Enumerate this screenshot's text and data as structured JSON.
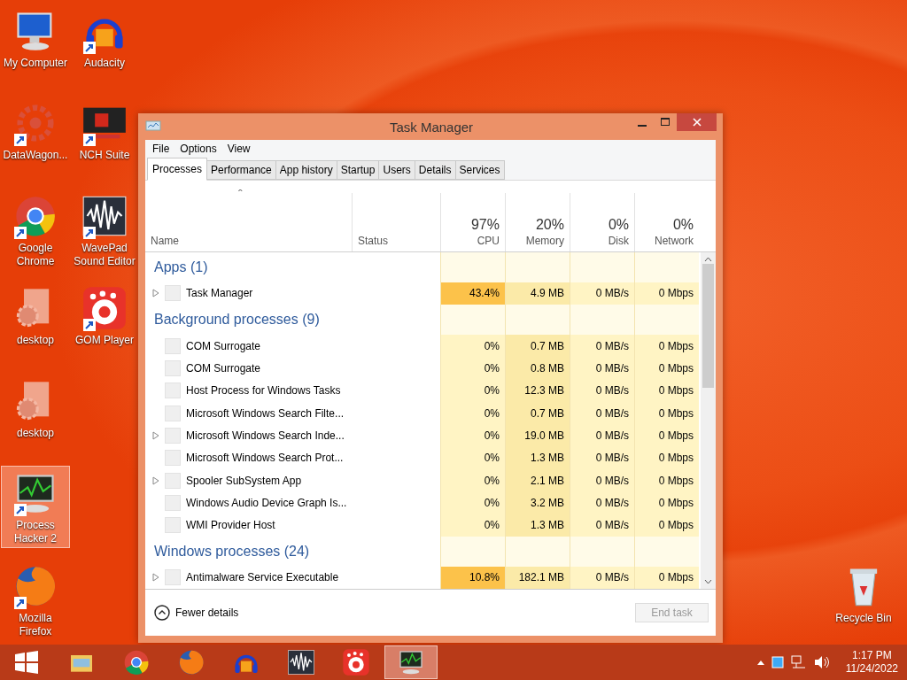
{
  "desktop_icons": [
    {
      "label": "My Computer",
      "kind": "computer",
      "shortcut": false,
      "selected": false
    },
    {
      "label": "Audacity",
      "kind": "headphones",
      "shortcut": true,
      "selected": false
    },
    {
      "label": "DataWagon...",
      "kind": "gear",
      "shortcut": true,
      "selected": false
    },
    {
      "label": "NCH Suite",
      "kind": "nch",
      "shortcut": true,
      "selected": false
    },
    {
      "label": "Google Chrome",
      "kind": "chrome",
      "shortcut": true,
      "selected": false
    },
    {
      "label": "WavePad Sound Editor",
      "kind": "wave",
      "shortcut": true,
      "selected": false
    },
    {
      "label": "desktop",
      "kind": "gear-doc",
      "shortcut": false,
      "selected": false
    },
    {
      "label": "GOM Player",
      "kind": "gom",
      "shortcut": true,
      "selected": false
    },
    {
      "label": "desktop",
      "kind": "gear-doc",
      "shortcut": false,
      "selected": false
    },
    {
      "label": "Process Hacker 2",
      "kind": "monitor",
      "shortcut": true,
      "selected": true
    },
    {
      "label": "Mozilla Firefox",
      "kind": "firefox",
      "shortcut": true,
      "selected": false
    },
    {
      "label": "Recycle Bin",
      "kind": "bin",
      "shortcut": false,
      "selected": false
    }
  ],
  "window": {
    "title": "Task Manager",
    "menu": [
      "File",
      "Options",
      "View"
    ],
    "tabs": [
      {
        "label": "Processes",
        "selected": true
      },
      {
        "label": "Performance",
        "selected": false
      },
      {
        "label": "App history",
        "selected": false
      },
      {
        "label": "Startup",
        "selected": false
      },
      {
        "label": "Users",
        "selected": false
      },
      {
        "label": "Details",
        "selected": false
      },
      {
        "label": "Services",
        "selected": false
      }
    ],
    "columns": [
      {
        "label": "Name"
      },
      {
        "label": "Status"
      },
      {
        "label": "CPU",
        "total": "97%"
      },
      {
        "label": "Memory",
        "total": "20%"
      },
      {
        "label": "Disk",
        "total": "0%"
      },
      {
        "label": "Network",
        "total": "0%"
      }
    ],
    "sort_indicator": "ˆ",
    "groups": [
      {
        "title": "Apps (1)",
        "rows": [
          {
            "name": "Task Manager",
            "expandable": true,
            "hot": true,
            "cpu": "43.4%",
            "memory": "4.9 MB",
            "disk": "0 MB/s",
            "network": "0 Mbps"
          }
        ]
      },
      {
        "title": "Background processes (9)",
        "rows": [
          {
            "name": "COM Surrogate",
            "expandable": false,
            "hot": false,
            "cpu": "0%",
            "memory": "0.7 MB",
            "disk": "0 MB/s",
            "network": "0 Mbps"
          },
          {
            "name": "COM Surrogate",
            "expandable": false,
            "hot": false,
            "cpu": "0%",
            "memory": "0.8 MB",
            "disk": "0 MB/s",
            "network": "0 Mbps"
          },
          {
            "name": "Host Process for Windows Tasks",
            "expandable": false,
            "hot": false,
            "cpu": "0%",
            "memory": "12.3 MB",
            "disk": "0 MB/s",
            "network": "0 Mbps"
          },
          {
            "name": "Microsoft Windows Search Filte...",
            "expandable": false,
            "hot": false,
            "cpu": "0%",
            "memory": "0.7 MB",
            "disk": "0 MB/s",
            "network": "0 Mbps"
          },
          {
            "name": "Microsoft Windows Search Inde...",
            "expandable": true,
            "hot": false,
            "cpu": "0%",
            "memory": "19.0 MB",
            "disk": "0 MB/s",
            "network": "0 Mbps"
          },
          {
            "name": "Microsoft Windows Search Prot...",
            "expandable": false,
            "hot": false,
            "cpu": "0%",
            "memory": "1.3 MB",
            "disk": "0 MB/s",
            "network": "0 Mbps"
          },
          {
            "name": "Spooler SubSystem App",
            "expandable": true,
            "hot": false,
            "cpu": "0%",
            "memory": "2.1 MB",
            "disk": "0 MB/s",
            "network": "0 Mbps"
          },
          {
            "name": "Windows Audio Device Graph Is...",
            "expandable": false,
            "hot": false,
            "cpu": "0%",
            "memory": "3.2 MB",
            "disk": "0 MB/s",
            "network": "0 Mbps"
          },
          {
            "name": "WMI Provider Host",
            "expandable": false,
            "hot": false,
            "cpu": "0%",
            "memory": "1.3 MB",
            "disk": "0 MB/s",
            "network": "0 Mbps"
          }
        ]
      },
      {
        "title": "Windows processes (24)",
        "rows": [
          {
            "name": "Antimalware Service Executable",
            "expandable": true,
            "hot": true,
            "cpu": "10.8%",
            "memory": "182.1 MB",
            "disk": "0 MB/s",
            "network": "0 Mbps"
          }
        ]
      }
    ],
    "fewer_details": "Fewer details",
    "end_task": {
      "label": "End task",
      "disabled": true
    }
  },
  "taskbar": [
    {
      "kind": "start",
      "selected": false
    },
    {
      "kind": "folder",
      "selected": false
    },
    {
      "kind": "chrome",
      "selected": false
    },
    {
      "kind": "firefox",
      "selected": false
    },
    {
      "kind": "headphones",
      "selected": false
    },
    {
      "kind": "wave",
      "selected": false
    },
    {
      "kind": "gom",
      "selected": false
    },
    {
      "kind": "monitor",
      "selected": true
    }
  ],
  "tray": {
    "time": "1:17 PM",
    "date": "11/24/2022"
  }
}
